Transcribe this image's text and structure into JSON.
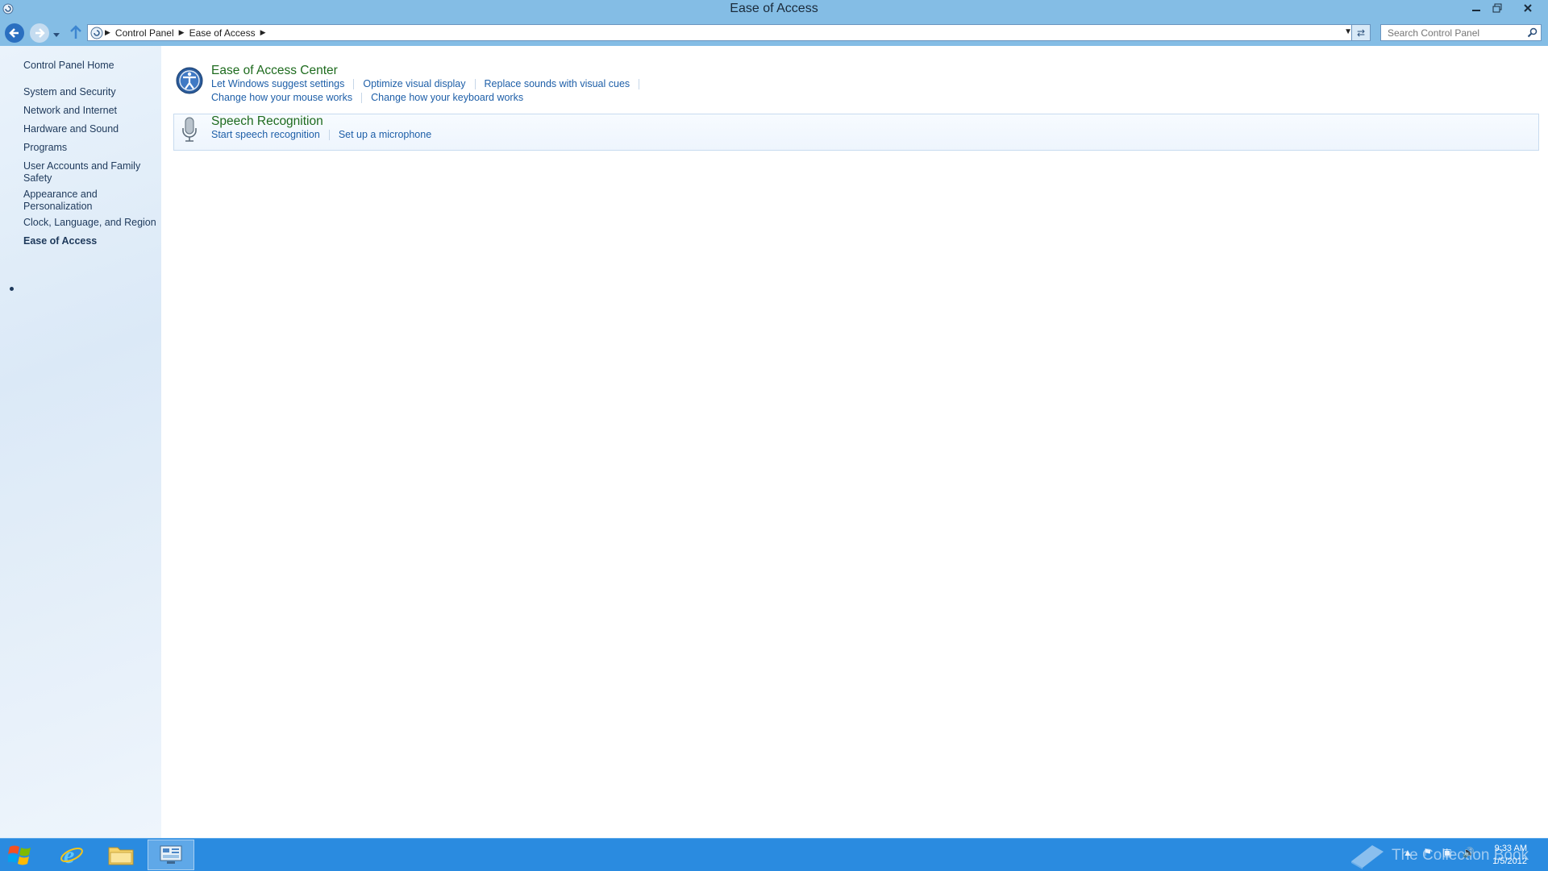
{
  "window": {
    "title": "Ease of Access"
  },
  "address": {
    "crumbs": [
      "Control Panel",
      "Ease of Access"
    ]
  },
  "search": {
    "placeholder": "Search Control Panel"
  },
  "sidebar": {
    "home": "Control Panel Home",
    "items": [
      {
        "label": "System and Security"
      },
      {
        "label": "Network and Internet"
      },
      {
        "label": "Hardware and Sound"
      },
      {
        "label": "Programs"
      },
      {
        "label": "User Accounts and Family Safety"
      },
      {
        "label": "Appearance and Personalization"
      },
      {
        "label": "Clock, Language, and Region"
      },
      {
        "label": "Ease of Access"
      }
    ]
  },
  "groups": {
    "ease_center": {
      "title": "Ease of Access Center",
      "links_row1": [
        "Let Windows suggest settings",
        "Optimize visual display",
        "Replace sounds with visual cues"
      ],
      "links_row2": [
        "Change how your mouse works",
        "Change how your keyboard works"
      ]
    },
    "speech": {
      "title": "Speech Recognition",
      "links": [
        "Start speech recognition",
        "Set up a microphone"
      ]
    }
  },
  "taskbar": {
    "watermark": "The Collection Book",
    "time": "9:33 AM",
    "date": "1/5/2012"
  },
  "colors": {
    "titlebar": "#84bde5",
    "taskbar": "#2a8be0",
    "link": "#1e5fa8",
    "group_title": "#1e6b1e"
  }
}
